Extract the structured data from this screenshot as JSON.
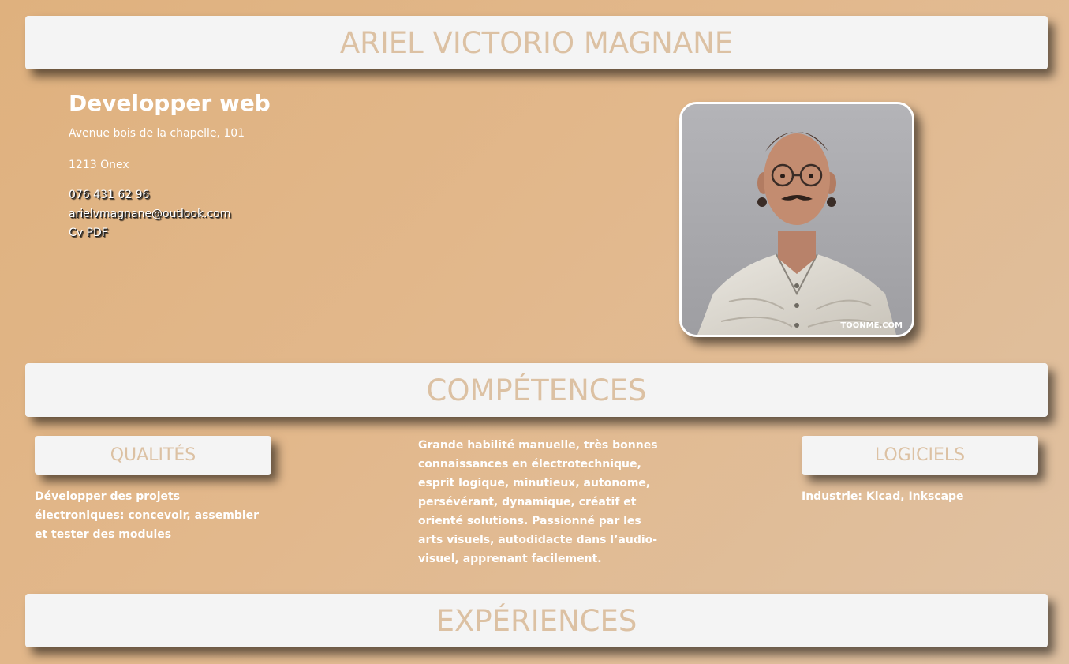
{
  "header": {
    "name": "ARIEL VICTORIO MAGNANE"
  },
  "profile": {
    "role": "Developper web",
    "address_line1": "Avenue bois de la chapelle, 101",
    "address_line2": "1213 Onex",
    "phone": "076 431 62 96",
    "email": "arielvmagnane@outlook.com",
    "cv_link": "Cv PDF"
  },
  "photo": {
    "watermark": "TOONME.COM"
  },
  "competences": {
    "title": "COMPÉTENCES",
    "qualites_title": "QUALITÉS",
    "qualites_text": "Développer des projets électroniques: concevoir, assembler et tester des modules",
    "middle_text": "Grande habilité manuelle, très bonnes connaissances en électrotechnique, esprit logique, minutieux, autonome, persévérant, dynamique, créatif et orienté solutions. Passionné par les arts visuels, autodidacte dans l’audio-visuel, apprenant facilement.",
    "logiciels_title": "LOGICIELS",
    "logiciels_text": "Industrie: Kicad, Inkscape"
  },
  "experiences": {
    "title": "EXPÉRIENCES"
  },
  "colors": {
    "background": "#dfb17e",
    "banner": "#f4f4f4",
    "banner_text": "#dcc1a3",
    "text": "#ffffff"
  }
}
